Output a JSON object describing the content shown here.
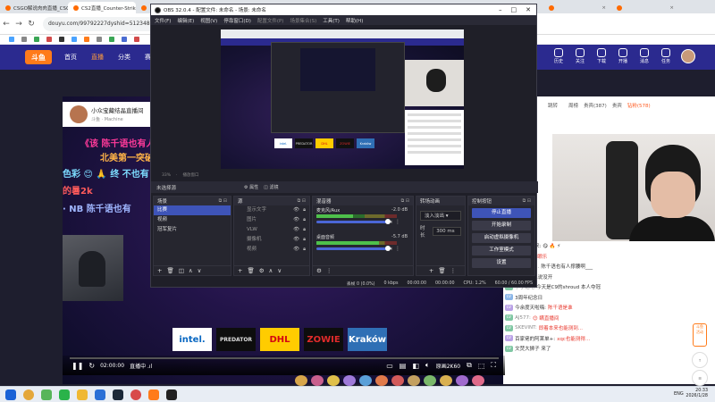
{
  "browser": {
    "tabs": [
      {
        "label": "CSGO解说肉肉直播_CSGO斗鱼...",
        "active": false
      },
      {
        "label": "CS2直播_Counter-Strike 2直播...",
        "active": true
      },
      {
        "label": "",
        "active": false
      },
      {
        "label": "",
        "active": false
      },
      {
        "label": "",
        "active": false
      },
      {
        "label": "",
        "active": false
      },
      {
        "label": "",
        "active": false
      },
      {
        "label": "",
        "active": false
      },
      {
        "label": "",
        "active": false
      },
      {
        "label": "",
        "active": false
      }
    ],
    "url": "douyu.com/99792227dyshid=512348"
  },
  "douyu": {
    "logo": "斗鱼",
    "nav": [
      "首页",
      "直播",
      "分类",
      "赛事"
    ],
    "active_nav": "直播",
    "right_icons": [
      {
        "name": "history-icon",
        "label": "历史"
      },
      {
        "name": "follow-icon",
        "label": "关注"
      },
      {
        "name": "download-icon",
        "label": "下载"
      },
      {
        "name": "broadcast-icon",
        "label": "开播"
      },
      {
        "name": "message-icon",
        "label": "消息"
      },
      {
        "name": "task-icon",
        "label": "任务"
      }
    ]
  },
  "room": {
    "title": "小众宝藏结晶直播间",
    "subtitle": "斗鱼 · Machine"
  },
  "danmu": [
    {
      "text": "《该 陈千语也有人",
      "color": "#ff3a9a"
    },
    {
      "text": "北美第一突破",
      "color": "#ffb347"
    },
    {
      "text": "色彩 😊 🙏 终 不也有",
      "color": "#7ddcff"
    },
    {
      "text": "的暑2k",
      "color": "#ff5b5b"
    },
    {
      "text": "· NB   陈千语也有",
      "color": "#9fb6ff"
    }
  ],
  "sponsors": [
    {
      "label": "intel.",
      "bg": "#ffffff",
      "fg": "#0a68c2"
    },
    {
      "label": "PREDATOR",
      "bg": "#0d0d0d",
      "fg": "#dddddd"
    },
    {
      "label": "DHL",
      "bg": "#ffcc00",
      "fg": "#d40511"
    },
    {
      "label": "ZOWIE",
      "bg": "#0d0d0d",
      "fg": "#e12b2b"
    },
    {
      "label": "Kraków",
      "bg": "#2f6fb5",
      "fg": "#ffffff"
    }
  ],
  "player": {
    "time": "02:00:00",
    "live_label": "直播中 .ıl",
    "quality": "原画2K60"
  },
  "right_panel": {
    "tabs": [
      "跳转",
      "",
      "周榜",
      "贵宾(387)",
      "贵宾",
      "钻粉(578)"
    ],
    "active_tab": "钻粉(578)"
  },
  "chat": [
    {
      "badge": "",
      "user": "",
      "text": "我喝迷的来: 😋 🔥 ⚡",
      "hl": ""
    },
    {
      "badge": "",
      "user": "",
      "text": "",
      "hl": "🔥 这才叫眼乐"
    },
    {
      "badge": "",
      "user": "黯黯黑骑...",
      "text": "陈千语也有人撑腰啊___",
      "hl": ""
    },
    {
      "badge": "",
      "user": "",
      "text": "饼说: 怎么说没开",
      "hl": ""
    },
    {
      "badge": "",
      "user": "小丁贴吧",
      "text": "今天是C9的shroud 本人夺冠",
      "hl": ""
    },
    {
      "badge": "",
      "user": "",
      "text": "3周年纪念日",
      "hl": ""
    },
    {
      "badge": "",
      "user": "",
      "text": "今余度天啦嗨:",
      "hl": "陈千语是谁"
    },
    {
      "badge": "",
      "user": "AJ577:",
      "text": "",
      "hl": "😊 瞒直播间"
    },
    {
      "badge": "",
      "user": "SKEVINT:",
      "text": "",
      "hl": "即着本来也能测到..."
    },
    {
      "badge": "",
      "user": "",
      "text": "百家佬的阿莱单+:",
      "hl": "xqc也能测得..."
    },
    {
      "badge": "",
      "user": "",
      "text": "文焚大狮子 来了",
      "hl": ""
    }
  ],
  "obs": {
    "title": "OBS 32.0.4 - 配置文件: 未命名 - 场景: 未命名",
    "menu": [
      "文件(F)",
      "编辑(E)",
      "视图(V)",
      "停靠窗口(D)",
      "配置文件(P)",
      "场景集合(S)",
      "工具(T)",
      "帮助(H)"
    ],
    "preview_status": [
      "33%",
      "·",
      "播放窗口"
    ],
    "source_bar": {
      "label": "未选择源",
      "properties": "属性",
      "filters": "滤镜"
    },
    "docks": {
      "scenes": {
        "title": "场景",
        "items": [
          "比赛",
          "视频",
          "冠军复片"
        ],
        "selected": "比赛"
      },
      "sources": {
        "title": "源",
        "items": [
          "显示文字",
          "图片",
          "VLW",
          "摄像机",
          "视频"
        ]
      },
      "mixer": {
        "title": "混音器",
        "channels": [
          {
            "name": "麦克风/Aux",
            "db": "-2.0 dB",
            "level": 0.45
          },
          {
            "name": "桌面音频",
            "db": "-5.7 dB",
            "level": 0.78
          }
        ]
      },
      "transitions": {
        "title": "转场动画",
        "type": "淡入淡出",
        "duration_label": "时长",
        "duration": "300 ms"
      },
      "controls": {
        "title": "控制按钮",
        "buttons": [
          "停止直播",
          "开始录制",
          "启动虚拟摄像机",
          "工作室模式",
          "设置"
        ]
      }
    },
    "status": [
      "丢帧 0 (0.0%)",
      "0 kbps",
      "00:00:00",
      "00:00:00",
      "CPU: 1.2%",
      "60.00 / 60.00 FPS"
    ]
  },
  "taskbar": {
    "lang": "ENG",
    "time": "20:33",
    "date": "2026/1/28"
  },
  "colors": {
    "douyu_header": "#2b2a8f",
    "douyu_orange": "#ff7b1a",
    "obs_accent": "#3e54b8",
    "obs_bg": "#1f1f28"
  }
}
